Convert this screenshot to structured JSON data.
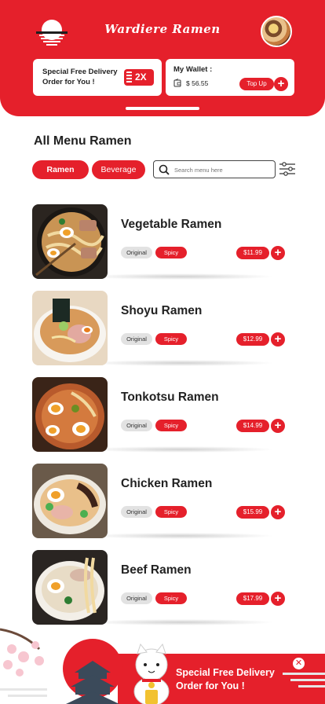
{
  "header": {
    "brand": "Wardiere Ramen",
    "delivery_promo": {
      "line1": "Special Free Delivery",
      "line2": "Order for You !",
      "badge": "2X"
    },
    "wallet": {
      "title": "My Wallet :",
      "amount": "$ 56.55",
      "top_up_label": "Top Up"
    }
  },
  "menu": {
    "title": "All Menu Ramen",
    "tabs": [
      {
        "label": "Ramen",
        "active": true
      },
      {
        "label": "Beverage",
        "active": false
      }
    ],
    "search": {
      "placeholder": "Search menu here"
    },
    "items": [
      {
        "name": "Vegetable Ramen",
        "tags": [
          "Original",
          "Spicy"
        ],
        "price": "$11.99"
      },
      {
        "name": "Shoyu Ramen",
        "tags": [
          "Original",
          "Spicy"
        ],
        "price": "$12.99"
      },
      {
        "name": "Tonkotsu Ramen",
        "tags": [
          "Original",
          "Spicy"
        ],
        "price": "$14.99"
      },
      {
        "name": "Chicken Ramen",
        "tags": [
          "Original",
          "Spicy"
        ],
        "price": "$15.99"
      },
      {
        "name": "Beef Ramen",
        "tags": [
          "Original",
          "Spicy"
        ],
        "price": "$17.99"
      }
    ]
  },
  "promo_banner": {
    "line1": "Special Free Delivery",
    "line2": "Order for You !"
  },
  "colors": {
    "accent": "#e5202b",
    "text": "#1f1f1f",
    "tag_bg": "#e2e2e2"
  },
  "icons": [
    "rising-sun-logo-icon",
    "wallet-icon",
    "plus-icon",
    "search-icon",
    "filter-sliders-icon",
    "close-icon",
    "lucky-cat-icon"
  ]
}
